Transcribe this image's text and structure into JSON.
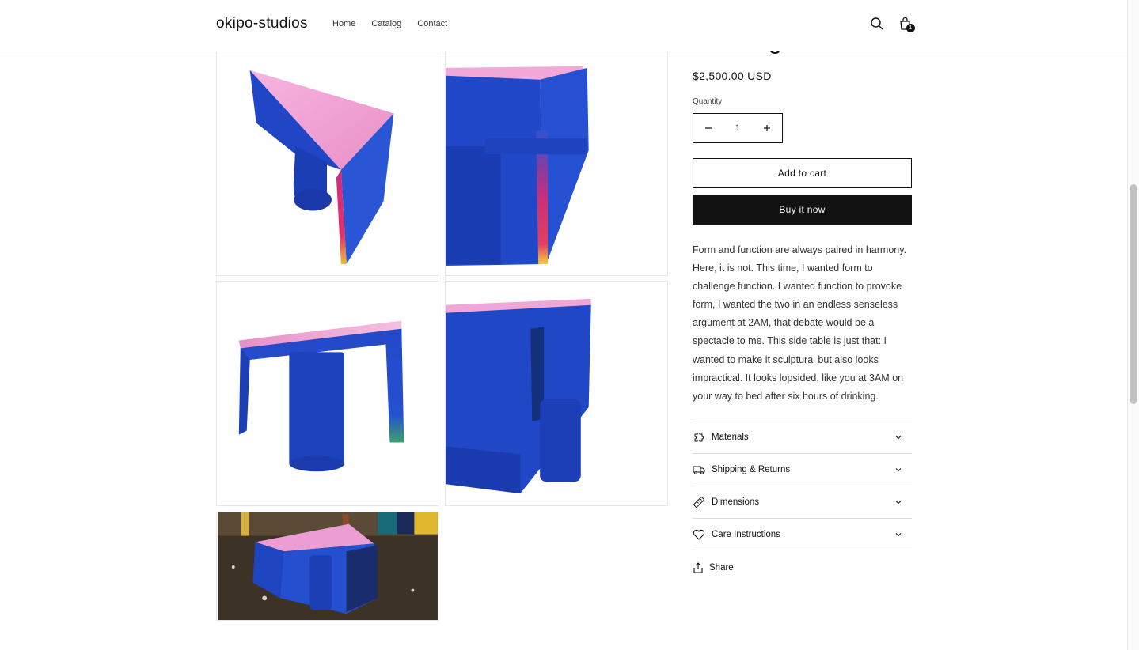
{
  "header": {
    "logo": "okipo-studios",
    "nav": [
      "Home",
      "Catalog",
      "Contact"
    ],
    "search_icon": "search-icon",
    "cart_icon": "cart-icon",
    "cart_count": "1"
  },
  "product": {
    "title_fragment": "g",
    "price": "$2,500.00 USD",
    "quantity_label": "Quantity",
    "quantity_value": "1",
    "add_to_cart": "Add to cart",
    "buy_now": "Buy it now",
    "description": "Form and function are always paired in harmony. Here, it is not. This time, I wanted form to challenge function. I wanted function to provoke form, I wanted the two in an endless senseless argument at 2AM, that debate would be a spectacle to me. This side table is just that: I wanted to make it sculptural but also looks impractical. It looks lopsided, like you at 3AM on your way to bed after six hours of drinking.",
    "accordion": [
      {
        "label": "Materials",
        "icon": "puzzle-icon"
      },
      {
        "label": "Shipping & Returns",
        "icon": "truck-icon"
      },
      {
        "label": "Dimensions",
        "icon": "ruler-icon"
      },
      {
        "label": "Care Instructions",
        "icon": "heart-icon"
      }
    ],
    "share": "Share"
  },
  "colors": {
    "blue": "#2047c9",
    "pink": "#f2a8d8",
    "black": "#121212"
  }
}
